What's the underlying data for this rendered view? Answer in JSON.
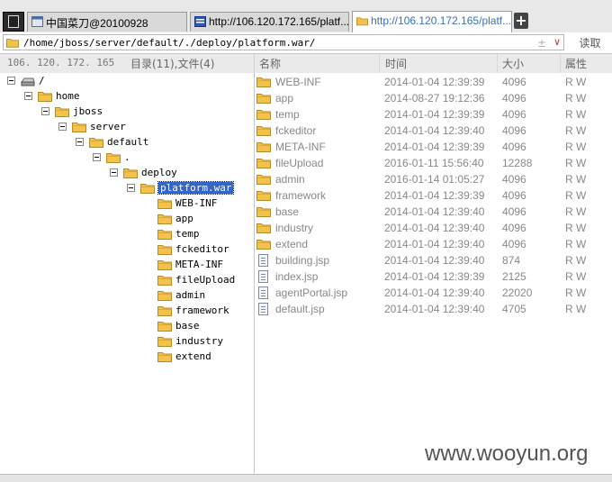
{
  "tabs": [
    {
      "label": "中国菜刀@20100928",
      "icon": "window-icon",
      "active": false
    },
    {
      "label": "http://106.120.172.165/platf...",
      "icon": "server-icon",
      "active": false
    },
    {
      "label": "http://106.120.172.165/platf...",
      "icon": "folder-icon",
      "active": true
    }
  ],
  "new_tab_label": "+",
  "address": {
    "path": "/home/jboss/server/default/./deploy/platform.war/",
    "plus_glyph": "±",
    "dropdown_glyph": "∨",
    "read_button": "读取"
  },
  "header": {
    "host": "106. 120. 172. 165",
    "counts": "目录(11),文件(4)",
    "col_name": "名称",
    "col_time": "时间",
    "col_size": "大小",
    "col_attr": "属性"
  },
  "tree": [
    {
      "label": "/",
      "icon": "drive-icon"
    },
    {
      "label": "home",
      "icon": "folder-icon"
    },
    {
      "label": "jboss",
      "icon": "folder-icon"
    },
    {
      "label": "server",
      "icon": "folder-icon"
    },
    {
      "label": "default",
      "icon": "folder-icon"
    },
    {
      "label": ".",
      "icon": "folder-icon"
    },
    {
      "label": "deploy",
      "icon": "folder-icon"
    },
    {
      "label": "platform.war",
      "icon": "folder-open-icon",
      "selected": true
    },
    {
      "label": "WEB-INF",
      "icon": "folder-icon"
    },
    {
      "label": "app",
      "icon": "folder-icon"
    },
    {
      "label": "temp",
      "icon": "folder-icon"
    },
    {
      "label": "fckeditor",
      "icon": "folder-icon"
    },
    {
      "label": "META-INF",
      "icon": "folder-icon"
    },
    {
      "label": "fileUpload",
      "icon": "folder-icon"
    },
    {
      "label": "admin",
      "icon": "folder-icon"
    },
    {
      "label": "framework",
      "icon": "folder-icon"
    },
    {
      "label": "base",
      "icon": "folder-icon"
    },
    {
      "label": "industry",
      "icon": "folder-icon"
    },
    {
      "label": "extend",
      "icon": "folder-icon"
    }
  ],
  "files": [
    {
      "name": "WEB-INF",
      "time": "2014-01-04 12:39:39",
      "size": "4096",
      "attr": "R W",
      "type": "folder"
    },
    {
      "name": "app",
      "time": "2014-08-27 19:12:36",
      "size": "4096",
      "attr": "R W",
      "type": "folder"
    },
    {
      "name": "temp",
      "time": "2014-01-04 12:39:39",
      "size": "4096",
      "attr": "R W",
      "type": "folder"
    },
    {
      "name": "fckeditor",
      "time": "2014-01-04 12:39:40",
      "size": "4096",
      "attr": "R W",
      "type": "folder"
    },
    {
      "name": "META-INF",
      "time": "2014-01-04 12:39:39",
      "size": "4096",
      "attr": "R W",
      "type": "folder"
    },
    {
      "name": "fileUpload",
      "time": "2016-01-11 15:56:40",
      "size": "12288",
      "attr": "R W",
      "type": "folder"
    },
    {
      "name": "admin",
      "time": "2016-01-14 01:05:27",
      "size": "4096",
      "attr": "R W",
      "type": "folder"
    },
    {
      "name": "framework",
      "time": "2014-01-04 12:39:39",
      "size": "4096",
      "attr": "R W",
      "type": "folder"
    },
    {
      "name": "base",
      "time": "2014-01-04 12:39:40",
      "size": "4096",
      "attr": "R W",
      "type": "folder"
    },
    {
      "name": "industry",
      "time": "2014-01-04 12:39:40",
      "size": "4096",
      "attr": "R W",
      "type": "folder"
    },
    {
      "name": "extend",
      "time": "2014-01-04 12:39:40",
      "size": "4096",
      "attr": "R W",
      "type": "folder"
    },
    {
      "name": "building.jsp",
      "time": "2014-01-04 12:39:40",
      "size": "874",
      "attr": "R W",
      "type": "file"
    },
    {
      "name": "index.jsp",
      "time": "2014-01-04 12:39:39",
      "size": "2125",
      "attr": "R W",
      "type": "file"
    },
    {
      "name": "agentPortal.jsp",
      "time": "2014-01-04 12:39:40",
      "size": "22020",
      "attr": "R W",
      "type": "file"
    },
    {
      "name": "default.jsp",
      "time": "2014-01-04 12:39:40",
      "size": "4705",
      "attr": "R W",
      "type": "file"
    }
  ],
  "watermark": "www.wooyun.org",
  "colors": {
    "selection": "#3366cc",
    "folder": "#f2c24a",
    "active_tab_text": "#3b6fb6"
  }
}
